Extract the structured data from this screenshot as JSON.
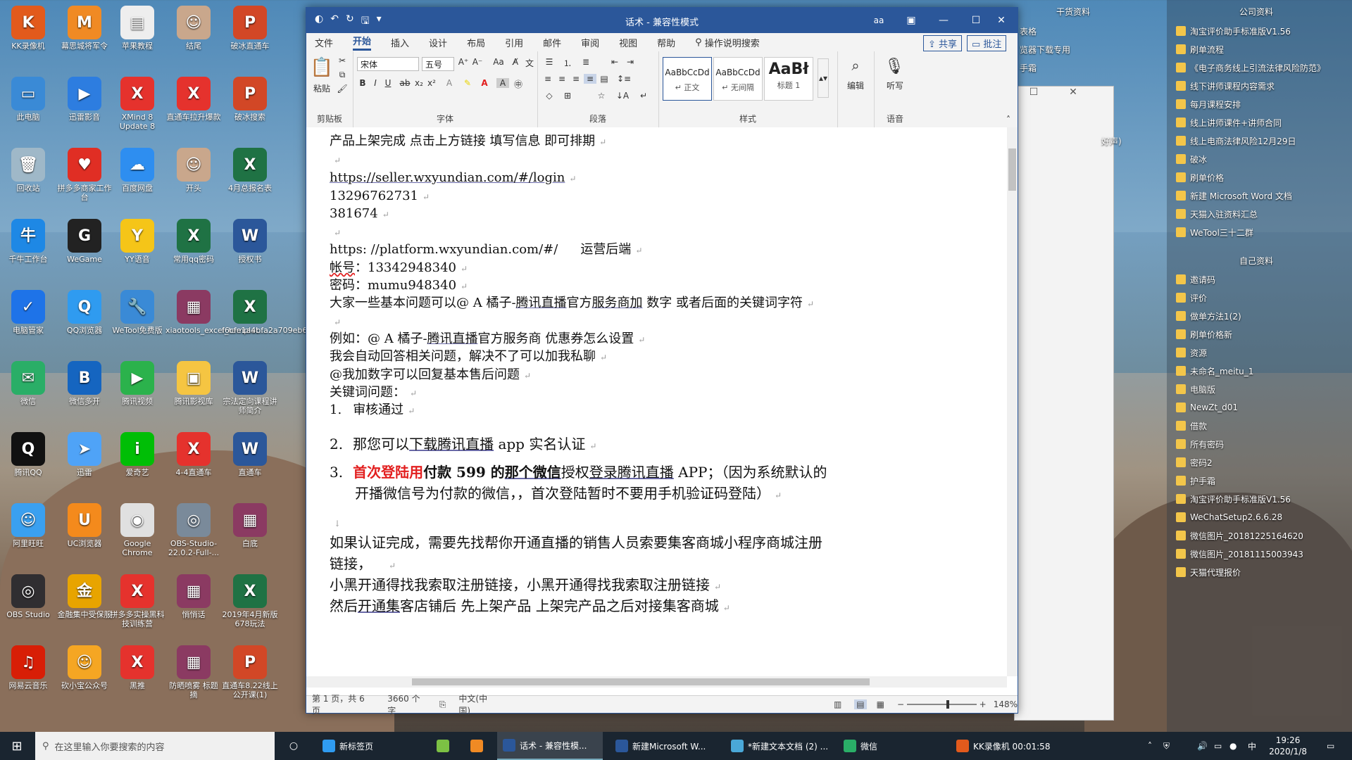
{
  "desktop": {
    "icons": [
      {
        "label": "KK录像机",
        "color": "#e25a1c",
        "glyph": "K"
      },
      {
        "label": "幕思城将军令",
        "color": "#f08a24",
        "glyph": "M"
      },
      {
        "label": "苹果教程",
        "color": "#eeeeee",
        "glyph": "▤"
      },
      {
        "label": "结尾",
        "color": "#c9a78c",
        "glyph": "☺"
      },
      {
        "label": "破冰直通车",
        "color": "#d24726",
        "glyph": "P"
      },
      {
        "label": "此电脑",
        "color": "#3a8ad6",
        "glyph": "▭"
      },
      {
        "label": "迅雷影音",
        "color": "#2d7de0",
        "glyph": "▶"
      },
      {
        "label": "XMind 8 Update 8",
        "color": "#e5322d",
        "glyph": "X"
      },
      {
        "label": "直通车拉升爆款",
        "color": "#e5322d",
        "glyph": "X"
      },
      {
        "label": "破冰搜索",
        "color": "#d24726",
        "glyph": "P"
      },
      {
        "label": "回收站",
        "color": "#9fb8c8",
        "glyph": "🗑"
      },
      {
        "label": "拼多多商家工作台",
        "color": "#e02e24",
        "glyph": "♥"
      },
      {
        "label": "百度网盘",
        "color": "#2e8ef0",
        "glyph": "☁"
      },
      {
        "label": "开头",
        "color": "#c9a78c",
        "glyph": "☺"
      },
      {
        "label": "4月总报名表",
        "color": "#1f7244",
        "glyph": "X"
      },
      {
        "label": "千牛工作台",
        "color": "#1e88e5",
        "glyph": "牛"
      },
      {
        "label": "WeGame",
        "color": "#222222",
        "glyph": "G"
      },
      {
        "label": "YY语音",
        "color": "#f5c518",
        "glyph": "Y"
      },
      {
        "label": "常用qq密码",
        "color": "#1f7244",
        "glyph": "X"
      },
      {
        "label": "授权书",
        "color": "#2b579a",
        "glyph": "W"
      },
      {
        "label": "电脑管家",
        "color": "#1e73e8",
        "glyph": "✓"
      },
      {
        "label": "QQ浏览器",
        "color": "#2f9bf0",
        "glyph": "Q"
      },
      {
        "label": "WeTool免费版",
        "color": "#3a8ad6",
        "glyph": "🔧"
      },
      {
        "label": "xiaotools_excel_templat...",
        "color": "#8b3a62",
        "glyph": "▦"
      },
      {
        "label": "f6cfe1a4bfa2a709eb67...",
        "color": "#1f7244",
        "glyph": "X"
      },
      {
        "label": "微信",
        "color": "#2aae67",
        "glyph": "✉"
      },
      {
        "label": "微信多开",
        "color": "#1565c0",
        "glyph": "B"
      },
      {
        "label": "腾讯视频",
        "color": "#2bb24c",
        "glyph": "▶"
      },
      {
        "label": "腾讯影视库",
        "color": "#f5c542",
        "glyph": "▣"
      },
      {
        "label": "宗法定向课程讲师简介",
        "color": "#2b579a",
        "glyph": "W"
      },
      {
        "label": "腾讯QQ",
        "color": "#111111",
        "glyph": "Q"
      },
      {
        "label": "迅雷",
        "color": "#4fa3f7",
        "glyph": "➤"
      },
      {
        "label": "爱奇艺",
        "color": "#00be06",
        "glyph": "i"
      },
      {
        "label": "4-4直通车",
        "color": "#e5322d",
        "glyph": "X"
      },
      {
        "label": "直通车",
        "color": "#2b579a",
        "glyph": "W"
      },
      {
        "label": "阿里旺旺",
        "color": "#3aa0f0",
        "glyph": "☺"
      },
      {
        "label": "UC浏览器",
        "color": "#f48a1c",
        "glyph": "U"
      },
      {
        "label": "Google Chrome",
        "color": "#e0e0e0",
        "glyph": "◉"
      },
      {
        "label": "OBS-Studio-22.0.2-Full-...",
        "color": "#7a8a9a",
        "glyph": "◎"
      },
      {
        "label": "白底",
        "color": "#8b3a62",
        "glyph": "▦"
      },
      {
        "label": "OBS Studio",
        "color": "#302e31",
        "glyph": "◎"
      },
      {
        "label": "金融集中受保服",
        "color": "#e8a400",
        "glyph": "金"
      },
      {
        "label": "拼多多实操黑科技训练营",
        "color": "#e5322d",
        "glyph": "X"
      },
      {
        "label": "悄悄话",
        "color": "#8b3a62",
        "glyph": "▦"
      },
      {
        "label": "2019年4月新版678玩法",
        "color": "#1f7244",
        "glyph": "X"
      },
      {
        "label": "网易云音乐",
        "color": "#d81e06",
        "glyph": "♫"
      },
      {
        "label": "砍小宝公众号",
        "color": "#f5a623",
        "glyph": "☺"
      },
      {
        "label": "黑推",
        "color": "#e5322d",
        "glyph": "X"
      },
      {
        "label": "防晒喷雾 标题摘",
        "color": "#8b3a62",
        "glyph": "▦"
      },
      {
        "label": "直通车8.22线上公开课(1)",
        "color": "#d24726",
        "glyph": "P"
      }
    ],
    "right_headers": [
      "干货资料",
      "公司资料",
      "自己资料"
    ],
    "right_items_top": [
      "淘宝评价助手标准版V1.56",
      "刷单流程",
      "《电子商务线上引流法律风险防范》",
      "线下讲师课程内容需求",
      "每月课程安排",
      "线上讲师课件+讲师合同",
      "线上电商法律风险12月29日",
      "破冰",
      "刷单价格",
      "新建 Microsoft Word 文档",
      "天猫入驻资料汇总",
      "WeTool三十二群"
    ],
    "right_items_bottom": [
      "邀请码",
      "评价",
      "做单方法1(2)",
      "刷单价格新",
      "资源",
      "未命名_meitu_1",
      "电脑版",
      "NewZt_d01",
      "借款",
      "所有密码",
      "密码2",
      "护手霜",
      "淘宝评价助手标准版V1.56",
      "WeChatSetup2.6.6.28",
      "微信图片_20181225164620",
      "微信图片_20181115003943",
      "天猫代理报价"
    ],
    "back_window_texts": [
      "表格",
      "览器下载专用",
      "手霜",
      "好声)"
    ]
  },
  "word": {
    "title": "话术 - 兼容性模式",
    "display_label": "aa",
    "menu": [
      "文件",
      "开始",
      "插入",
      "设计",
      "布局",
      "引用",
      "邮件",
      "审阅",
      "视图",
      "帮助"
    ],
    "search_hint": "操作说明搜索",
    "share_label": "共享",
    "comment_label": "批注",
    "font_name": "宋体",
    "font_size": "五号",
    "groups": {
      "clipboard": "剪贴板",
      "font": "字体",
      "paragraph": "段落",
      "styles": "样式",
      "voice": "语音"
    },
    "paste_label": "粘贴",
    "edit_label": "编辑",
    "dictate_label": "听写",
    "styles": [
      {
        "sample": "AaBbCcDd",
        "name": "↵ 正文"
      },
      {
        "sample": "AaBbCcDd",
        "name": "↵ 无间隔"
      },
      {
        "sample": "AaBł",
        "name": "标题 1"
      }
    ],
    "doc": {
      "l1": "产品上架完成 点击上方链接 填写信息 即可排期",
      "l2": "https://seller.wxyundian.com/#/login",
      "l3": "13296762731",
      "l4": "381674",
      "l5a": "https: //platform.wxyundian.com/#/",
      "l5b": "运营后端",
      "l6a": "帐号",
      "l6b": "：13342948340",
      "l7": "密码：mumu948340",
      "l8a": "大家一些基本问题可以@ A 橘子-",
      "l8b": "腾讯直播",
      "l8c": "官方",
      "l8d": "服务商加",
      "l8e": " 数字 或者后面的关键词字符",
      "l9a": "例如：@ A 橘子-",
      "l9b": "腾讯直播",
      "l9c": "官方服务商 优惠券怎么设置",
      "l10": "我会自动回答相关问题，解决不了可以加我私聊",
      "l11": "@我加数字可以回复基本售后问题",
      "l12": "关键词问题：",
      "n1": "1.",
      "i1": "审核通过",
      "n2": "2.",
      "i2a": "那您可以",
      "i2b": "下载腾讯直播",
      "i2c": " app 实名认证",
      "n3": "3.",
      "i3a": "首次登陆用",
      "i3b": "付款 599 的",
      "i3c": "那个微信",
      "i3d": "授权",
      "i3e": "登录腾讯直播",
      "i3f": " APP；（因为系统默认的",
      "i3g": "开播微信号为付款的微信，，首次登陆暂时不要用手机验证码登陆）",
      "l13": "如果认证完成，需要先找帮你开通直播的销售人员索要集客商城小程序商城注册",
      "l14": "链接，",
      "l15": "小黑开通得找我索取注册链接，小黑开通得找我索取注册链接",
      "l16a": "然后",
      "l16b": "开通集",
      "l16c": "客店铺后 先上架产品 上架完产品之后对接集客商城"
    },
    "status": {
      "page": "第 1 页，共 6 页",
      "words": "3660 个字",
      "lang": "中文(中国)",
      "zoom": "148%"
    }
  },
  "taskbar": {
    "search_placeholder": "在这里输入你要搜索的内容",
    "apps": [
      {
        "label": "新标签页",
        "color": "#2f9bf0"
      },
      {
        "label": "",
        "color": "#7cc144"
      },
      {
        "label": "",
        "color": "#f08a24"
      },
      {
        "label": "话术 - 兼容性模...",
        "color": "#2b579a"
      },
      {
        "label": "新建Microsoft W...",
        "color": "#2b579a"
      },
      {
        "label": "*新建文本文档 (2) ...",
        "color": "#4aa8d8"
      },
      {
        "label": "微信",
        "color": "#2aae67"
      },
      {
        "label": "KK录像机 00:01:58",
        "color": "#e25a1c"
      }
    ],
    "tray_ime": "中",
    "time": "19:26",
    "date": "2020/1/8"
  }
}
